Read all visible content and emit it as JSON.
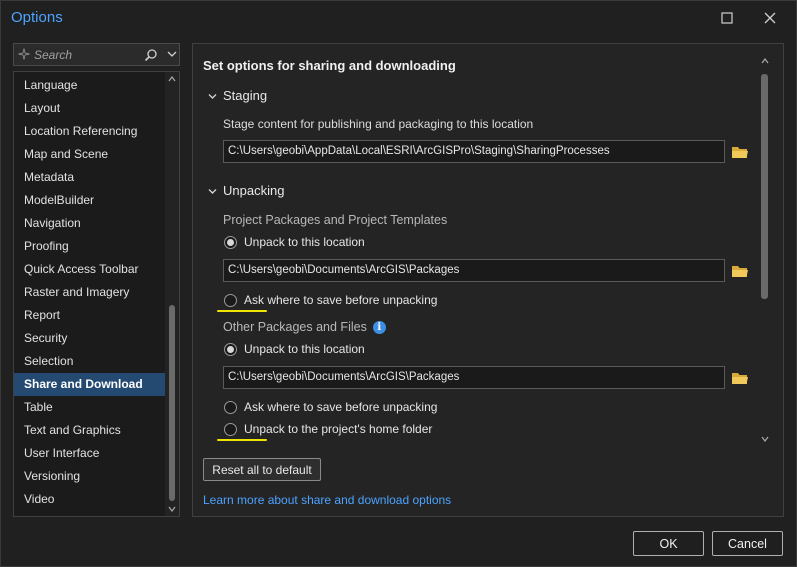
{
  "window": {
    "title": "Options"
  },
  "sidebar": {
    "search_placeholder": "Search",
    "items": [
      {
        "label": "Language"
      },
      {
        "label": "Layout"
      },
      {
        "label": "Location Referencing"
      },
      {
        "label": "Map and Scene"
      },
      {
        "label": "Metadata"
      },
      {
        "label": "ModelBuilder"
      },
      {
        "label": "Navigation"
      },
      {
        "label": "Proofing"
      },
      {
        "label": "Quick Access Toolbar"
      },
      {
        "label": "Raster and Imagery"
      },
      {
        "label": "Report"
      },
      {
        "label": "Security"
      },
      {
        "label": "Selection"
      },
      {
        "label": "Share and Download",
        "active": true
      },
      {
        "label": "Table"
      },
      {
        "label": "Text and Graphics"
      },
      {
        "label": "User Interface"
      },
      {
        "label": "Versioning"
      },
      {
        "label": "Video"
      }
    ]
  },
  "main": {
    "title": "Set options for sharing and downloading",
    "staging": {
      "header": "Staging",
      "description": "Stage content for publishing and packaging to this location",
      "path": "C:\\Users\\geobi\\AppData\\Local\\ESRI\\ArcGISPro\\Staging\\SharingProcesses"
    },
    "unpacking": {
      "header": "Unpacking",
      "project_packages": {
        "label": "Project Packages and Project Templates",
        "option_unpack": "Unpack to this location",
        "path": "C:\\Users\\geobi\\Documents\\ArcGIS\\Packages",
        "option_ask": "Ask where to save before unpacking",
        "selected": "unpack"
      },
      "other_packages": {
        "label": "Other Packages and Files",
        "option_unpack": "Unpack to this location",
        "path": "C:\\Users\\geobi\\Documents\\ArcGIS\\Packages",
        "option_ask": "Ask where to save before unpacking",
        "option_home": "Unpack to the project's home folder",
        "selected": "unpack"
      }
    },
    "reset_label": "Reset all to default",
    "learn_more": "Learn more about share and download options"
  },
  "footer": {
    "ok_label": "OK",
    "cancel_label": "Cancel"
  },
  "colors": {
    "accent": "#4ca3ff",
    "selection": "#244a72",
    "highlight": "#f0e400"
  }
}
